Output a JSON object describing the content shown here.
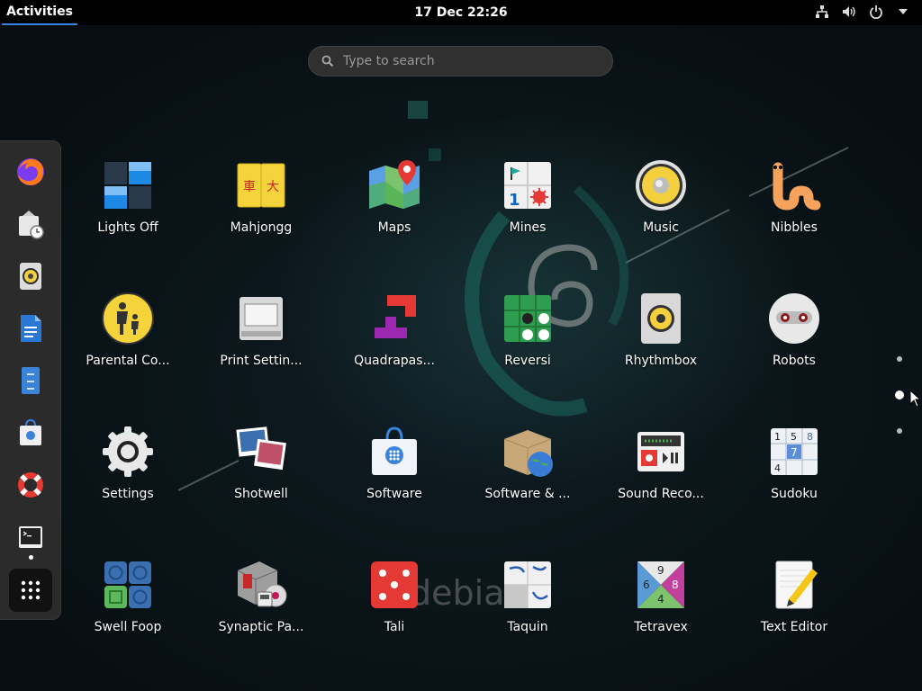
{
  "topbar": {
    "activities": "Activities",
    "clock": "17 Dec  22:26",
    "icons": [
      "network-icon",
      "volume-icon",
      "power-icon",
      "dropdown-icon"
    ]
  },
  "search": {
    "placeholder": "Type to search"
  },
  "dash": {
    "items": [
      "firefox",
      "evolution",
      "rhythmbox",
      "libreoffice-writer",
      "file-manager",
      "software",
      "help",
      "terminal",
      "show-applications"
    ]
  },
  "apps": [
    {
      "label": "Lights Off"
    },
    {
      "label": "Mahjongg"
    },
    {
      "label": "Maps"
    },
    {
      "label": "Mines"
    },
    {
      "label": "Music"
    },
    {
      "label": "Nibbles"
    },
    {
      "label": "Parental Co..."
    },
    {
      "label": "Print Settin..."
    },
    {
      "label": "Quadrapas..."
    },
    {
      "label": "Reversi"
    },
    {
      "label": "Rhythmbox"
    },
    {
      "label": "Robots"
    },
    {
      "label": "Settings"
    },
    {
      "label": "Shotwell"
    },
    {
      "label": "Software"
    },
    {
      "label": "Software & ..."
    },
    {
      "label": "Sound Reco..."
    },
    {
      "label": "Sudoku"
    },
    {
      "label": "Swell Foop"
    },
    {
      "label": "Synaptic Pa..."
    },
    {
      "label": "Tali"
    },
    {
      "label": "Taquin"
    },
    {
      "label": "Tetravex"
    },
    {
      "label": "Text Editor"
    }
  ],
  "icon_glyphs": {
    "mahjongg": [
      "車",
      "大"
    ],
    "mines": "1",
    "sudoku": [
      "1",
      "5",
      "8",
      "7",
      "4"
    ],
    "tetravex": [
      "9",
      "6",
      "8",
      "4"
    ]
  },
  "wallpaper": {
    "text": "debian"
  },
  "pages": {
    "count": 3,
    "current": 2
  }
}
